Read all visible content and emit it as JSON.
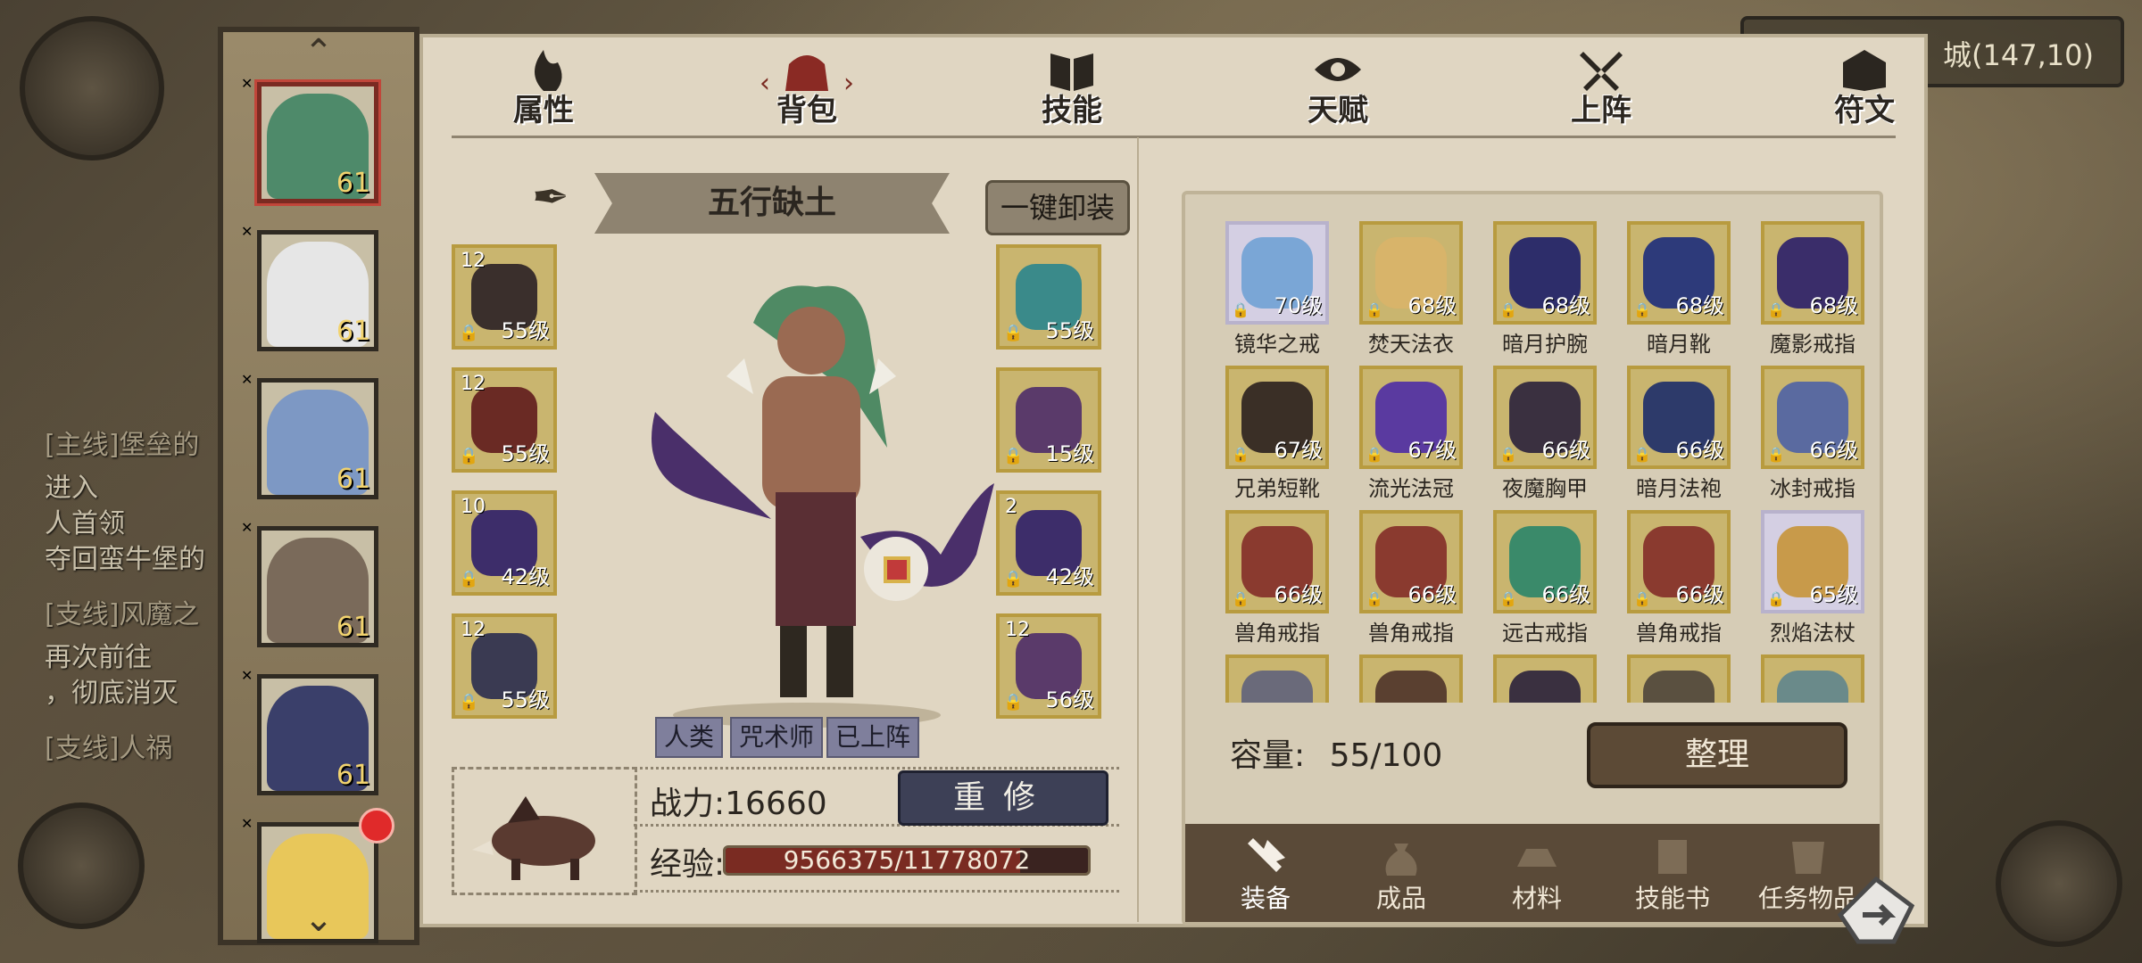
{
  "background": {
    "quests": [
      {
        "text": "[主线]堡垒的",
        "kind": "tag"
      },
      {
        "text": "进入",
        "kind": "body"
      },
      {
        "text": "人首领",
        "kind": "body"
      },
      {
        "text": "夺回蛮牛堡的",
        "kind": "body"
      },
      {
        "text": "[支线]风魔之",
        "kind": "tag"
      },
      {
        "text": "再次前往",
        "kind": "body"
      },
      {
        "text": "，彻底消灭",
        "kind": "body"
      },
      {
        "text": "[支线]人祸",
        "kind": "tag"
      }
    ],
    "coordinate_text": "城(147,10)"
  },
  "heroes": [
    {
      "level": "61",
      "color": "#4e8a6a",
      "active": true
    },
    {
      "level": "61",
      "color": "#e6e6e6",
      "active": false
    },
    {
      "level": "61",
      "color": "#7d98c4",
      "active": false
    },
    {
      "level": "61",
      "color": "#7a6a5a",
      "active": false
    },
    {
      "level": "61",
      "color": "#3a3f6a",
      "active": false
    },
    {
      "level": "",
      "color": "#e8c75a",
      "active": false
    }
  ],
  "tabs": [
    {
      "label": "属性",
      "icon": "flame-icon",
      "active": false
    },
    {
      "label": "背包",
      "icon": "bag-icon",
      "active": true
    },
    {
      "label": "技能",
      "icon": "book-icon",
      "active": false
    },
    {
      "label": "天赋",
      "icon": "eye-icon",
      "active": false
    },
    {
      "label": "上阵",
      "icon": "crossed-swords-icon",
      "active": false
    },
    {
      "label": "符文",
      "icon": "rune-icon",
      "active": false
    }
  ],
  "equipment": {
    "title": "五行缺土",
    "unequip_all_label": "一键卸装",
    "left_slots": [
      {
        "enhance": "12",
        "level": "55级",
        "color": "#3a2f2c"
      },
      {
        "enhance": "12",
        "level": "55级",
        "color": "#6a2a24"
      },
      {
        "enhance": "10",
        "level": "42级",
        "color": "#3d2d6a"
      },
      {
        "enhance": "12",
        "level": "55级",
        "color": "#3a3a52"
      }
    ],
    "right_slots": [
      {
        "enhance": "",
        "level": "55级",
        "color": "#3a8a8a"
      },
      {
        "enhance": "",
        "level": "15级",
        "color": "#5a3a6a"
      },
      {
        "enhance": "2",
        "level": "42级",
        "color": "#3d2d6a"
      },
      {
        "enhance": "12",
        "level": "56级",
        "color": "#5a3a6a"
      }
    ],
    "tags": [
      "人类",
      "咒术师",
      "已上阵"
    ],
    "power_label": "战力:",
    "power_value": "16660",
    "rebuild_label": "重修",
    "exp_label": "经验:",
    "exp_text": "9566375/11778072",
    "exp_current": 9566375,
    "exp_max": 11778072
  },
  "inventory": {
    "items": [
      {
        "name": "镜华之戒",
        "level": "70级",
        "rarity": "purple",
        "color": "#7aa6d6"
      },
      {
        "name": "焚天法衣",
        "level": "68级",
        "rarity": "gold",
        "color": "#d8b46a"
      },
      {
        "name": "暗月护腕",
        "level": "68级",
        "rarity": "gold",
        "color": "#2d2d6a"
      },
      {
        "name": "暗月靴",
        "level": "68级",
        "rarity": "gold",
        "color": "#2d3a7a"
      },
      {
        "name": "魔影戒指",
        "level": "68级",
        "rarity": "gold",
        "color": "#3a2d6a"
      },
      {
        "name": "兄弟短靴",
        "level": "67级",
        "rarity": "gold",
        "color": "#3a2f26"
      },
      {
        "name": "流光法冠",
        "level": "67级",
        "rarity": "gold",
        "color": "#5a3aa0"
      },
      {
        "name": "夜魔胸甲",
        "level": "66级",
        "rarity": "gold",
        "color": "#3a3040"
      },
      {
        "name": "暗月法袍",
        "level": "66级",
        "rarity": "gold",
        "color": "#2d3a6a"
      },
      {
        "name": "冰封戒指",
        "level": "66级",
        "rarity": "gold",
        "color": "#5a6aa0"
      },
      {
        "name": "兽角戒指",
        "level": "66级",
        "rarity": "gold",
        "color": "#8a3a2f"
      },
      {
        "name": "兽角戒指",
        "level": "66级",
        "rarity": "gold",
        "color": "#8a3a2f"
      },
      {
        "name": "远古戒指",
        "level": "66级",
        "rarity": "gold",
        "color": "#3a8a6a"
      },
      {
        "name": "兽角戒指",
        "level": "66级",
        "rarity": "gold",
        "color": "#8a3a2f"
      },
      {
        "name": "烈焰法杖",
        "level": "65级",
        "rarity": "purple",
        "color": "#c89a4a"
      },
      {
        "name": "",
        "level": "",
        "rarity": "gold",
        "color": "#6a6a7a"
      },
      {
        "name": "",
        "level": "",
        "rarity": "gold",
        "color": "#5a4030"
      },
      {
        "name": "",
        "level": "",
        "rarity": "gold",
        "color": "#3a3040"
      },
      {
        "name": "",
        "level": "",
        "rarity": "gold",
        "color": "#5a5040"
      },
      {
        "name": "",
        "level": "",
        "rarity": "gold",
        "color": "#6a8a8a"
      }
    ],
    "capacity_label": "容量:",
    "capacity_value": "55/100",
    "sort_label": "整理",
    "bottom_tabs": [
      {
        "label": "装备",
        "icon": "hammer-icon",
        "active": true
      },
      {
        "label": "成品",
        "icon": "sack-icon",
        "active": false
      },
      {
        "label": "材料",
        "icon": "ingot-icon",
        "active": false
      },
      {
        "label": "技能书",
        "icon": "scroll-icon",
        "active": false
      },
      {
        "label": "任务物品",
        "icon": "task-scroll-icon",
        "active": false
      }
    ]
  }
}
